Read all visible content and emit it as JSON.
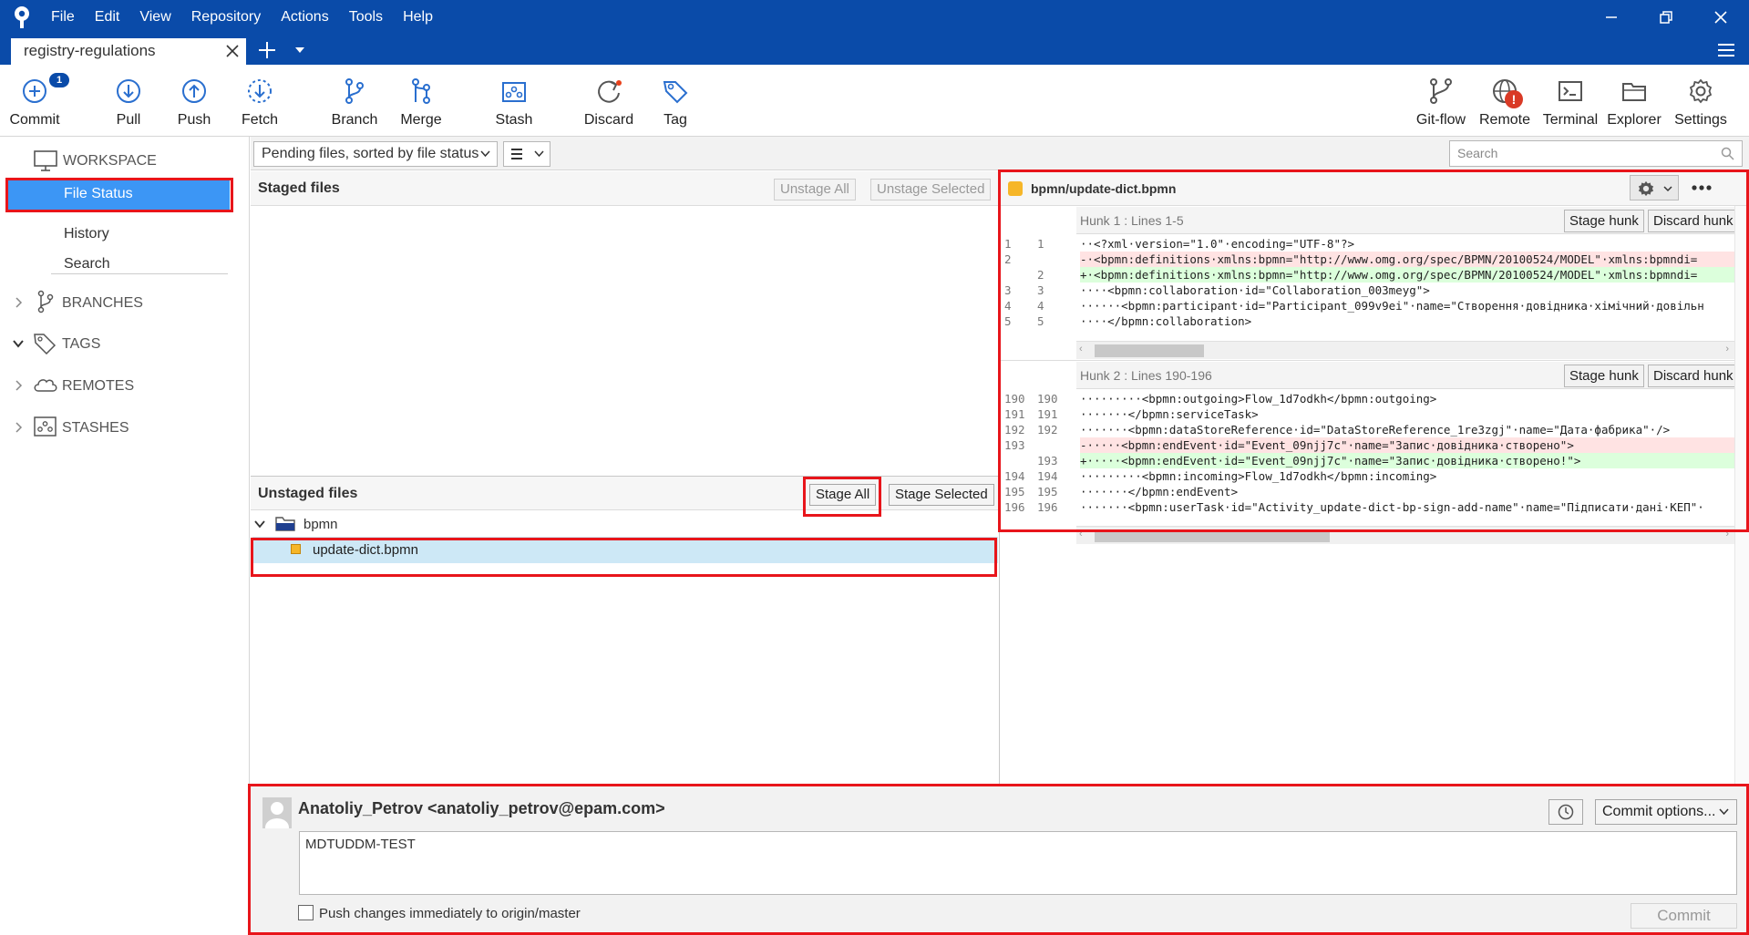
{
  "menu": [
    "File",
    "Edit",
    "View",
    "Repository",
    "Actions",
    "Tools",
    "Help"
  ],
  "tab": {
    "name": "registry-regulations"
  },
  "toolbar": {
    "commit": "Commit",
    "commit_badge": "1",
    "pull": "Pull",
    "push": "Push",
    "fetch": "Fetch",
    "branch": "Branch",
    "merge": "Merge",
    "stash": "Stash",
    "discard": "Discard",
    "tag": "Tag",
    "gitflow": "Git-flow",
    "remote": "Remote",
    "remote_alert": "!",
    "terminal": "Terminal",
    "explorer": "Explorer",
    "settings": "Settings"
  },
  "sidebar": {
    "workspace": "WORKSPACE",
    "file_status": "File Status",
    "history": "History",
    "search": "Search",
    "branches": "BRANCHES",
    "tags": "TAGS",
    "remotes": "REMOTES",
    "stashes": "STASHES"
  },
  "filter": {
    "sort_label": "Pending files, sorted by file status",
    "search_placeholder": "Search"
  },
  "staged": {
    "title": "Staged files",
    "unstage_all": "Unstage All",
    "unstage_selected": "Unstage Selected"
  },
  "unstaged": {
    "title": "Unstaged files",
    "stage_all": "Stage All",
    "stage_selected": "Stage Selected",
    "folder": "bpmn",
    "file": "update-dict.bpmn"
  },
  "diff": {
    "file_path": "bpmn/update-dict.bpmn",
    "stage_hunk": "Stage hunk",
    "discard_hunk": "Discard hunk",
    "hunks": [
      {
        "label": "Hunk 1 : Lines 1-5",
        "lines": [
          {
            "old": "1",
            "new": "1",
            "type": "ctx",
            "text": "··<?xml·version=\"1.0\"·encoding=\"UTF-8\"?>"
          },
          {
            "old": "2",
            "new": "",
            "type": "del",
            "text": "-·<bpmn:definitions·xmlns:bpmn=\"http://www.omg.org/spec/BPMN/20100524/MODEL\"·xmlns:bpmndi="
          },
          {
            "old": "",
            "new": "2",
            "type": "add",
            "text": "+·<bpmn:definitions·xmlns:bpmn=\"http://www.omg.org/spec/BPMN/20100524/MODEL\"·xmlns:bpmndi="
          },
          {
            "old": "3",
            "new": "3",
            "type": "ctx",
            "text": "····<bpmn:collaboration·id=\"Collaboration_003meyg\">"
          },
          {
            "old": "4",
            "new": "4",
            "type": "ctx",
            "text": "······<bpmn:participant·id=\"Participant_099v9ei\"·name=\"Створення·довідника·хімічний·довільн"
          },
          {
            "old": "5",
            "new": "5",
            "type": "ctx",
            "text": "····</bpmn:collaboration>"
          }
        ]
      },
      {
        "label": "Hunk 2 : Lines 190-196",
        "lines": [
          {
            "old": "190",
            "new": "190",
            "type": "ctx",
            "text": "·········<bpmn:outgoing>Flow_1d7odkh</bpmn:outgoing>"
          },
          {
            "old": "191",
            "new": "191",
            "type": "ctx",
            "text": "·······</bpmn:serviceTask>"
          },
          {
            "old": "192",
            "new": "192",
            "type": "ctx",
            "text": "·······<bpmn:dataStoreReference·id=\"DataStoreReference_1re3zgj\"·name=\"Дата·фабрика\"·/>"
          },
          {
            "old": "193",
            "new": "",
            "type": "del",
            "text": "-·····<bpmn:endEvent·id=\"Event_09njj7c\"·name=\"Запис·довідника·створено\">"
          },
          {
            "old": "",
            "new": "193",
            "type": "add",
            "text": "+·····<bpmn:endEvent·id=\"Event_09njj7c\"·name=\"Запис·довідника·створено!\">"
          },
          {
            "old": "194",
            "new": "194",
            "type": "ctx",
            "text": "·········<bpmn:incoming>Flow_1d7odkh</bpmn:incoming>"
          },
          {
            "old": "195",
            "new": "195",
            "type": "ctx",
            "text": "·······</bpmn:endEvent>"
          },
          {
            "old": "196",
            "new": "196",
            "type": "ctx",
            "text": "·······<bpmn:userTask·id=\"Activity_update-dict-bp-sign-add-name\"·name=\"Підписати·дані·КЕП\"·"
          }
        ]
      }
    ]
  },
  "commit": {
    "author": "Anatoliy_Petrov <anatoliy_petrov@epam.com>",
    "options": "Commit options...",
    "message": "MDTUDDM-TEST",
    "push_label": "Push changes immediately to origin/master",
    "button": "Commit"
  },
  "colors": {
    "titlebar": "#0a4ba9",
    "selection": "#3c96f5",
    "annotation": "#e8151b",
    "diff_added": "#dcffdc",
    "diff_removed": "#ffe3e3"
  }
}
